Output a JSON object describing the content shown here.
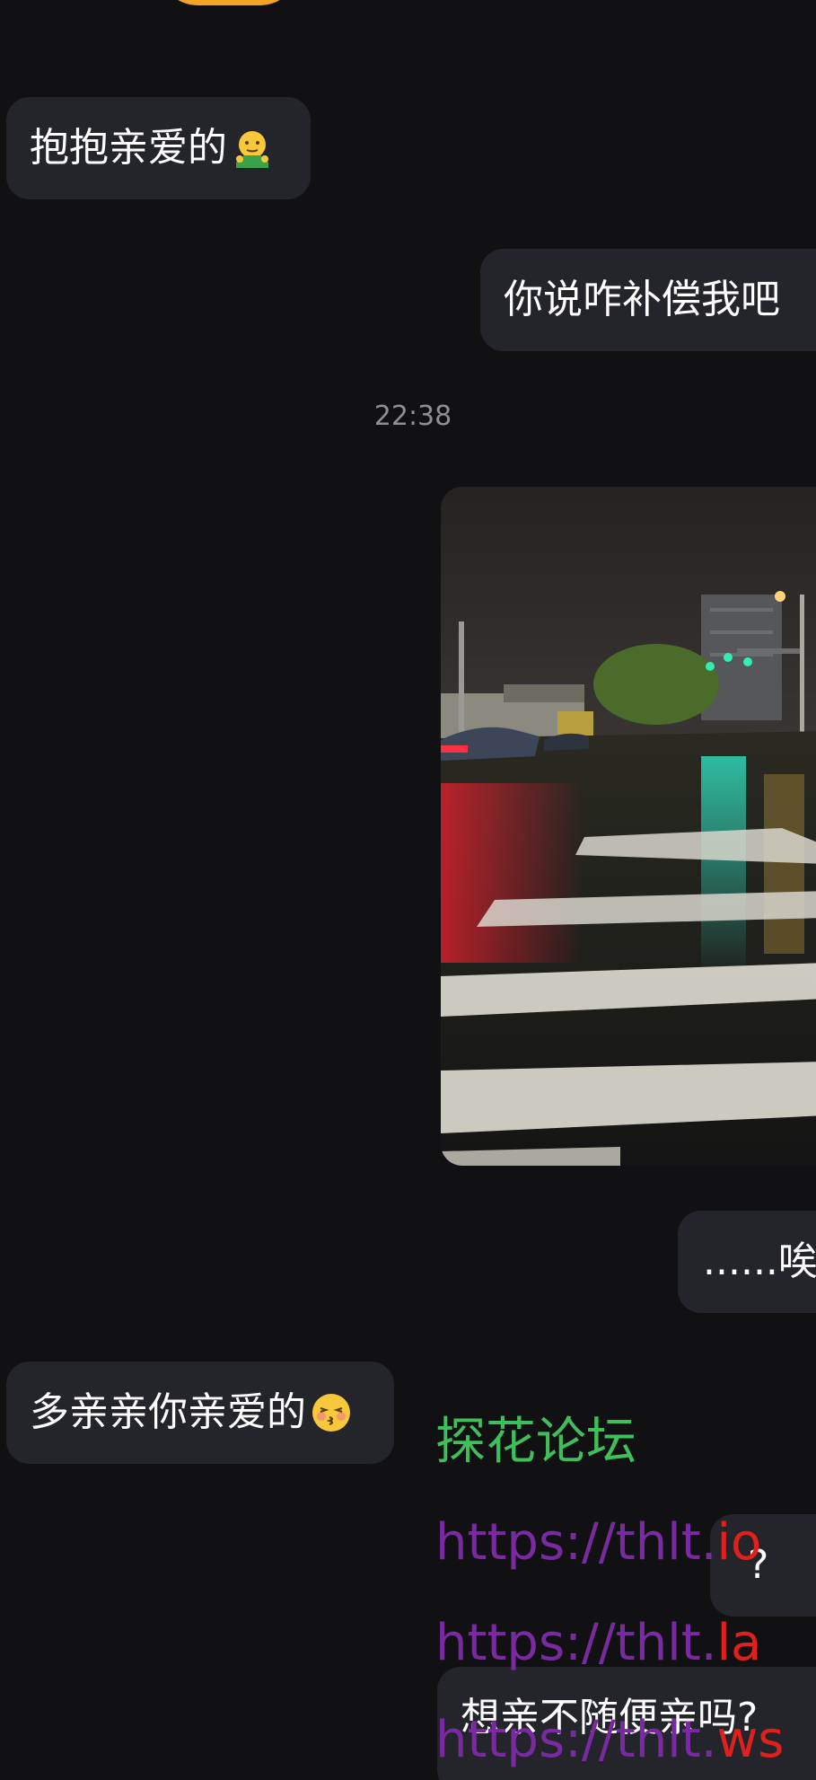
{
  "messages": [
    {
      "side": "left",
      "text": "抱抱亲爱的",
      "emoji": "hug-emoji"
    },
    {
      "side": "right",
      "text": "你说咋补偿我吧"
    },
    {
      "side": "right",
      "text": "......唉"
    },
    {
      "side": "left",
      "text": "多亲亲你亲爱的",
      "emoji": "kiss-emoji"
    },
    {
      "side": "right",
      "text": "?"
    },
    {
      "side": "right",
      "text": "想亲不随便亲吗?"
    }
  ],
  "timestamp": "22:38",
  "photo": {
    "description_icon": "night-street-photo"
  },
  "overlay": {
    "title": "探花论坛",
    "links": [
      {
        "prefix": "https://thlt.",
        "suffix": "io"
      },
      {
        "prefix": "https://thlt.",
        "suffix": "la"
      },
      {
        "prefix": "https://thlt.",
        "suffix": "ws"
      }
    ]
  },
  "colors": {
    "background": "#111114",
    "bubble": "#24252a",
    "overlay_title": "#3fbf5a",
    "overlay_link": "#7a2aa0",
    "overlay_domain": "#e0201c"
  }
}
